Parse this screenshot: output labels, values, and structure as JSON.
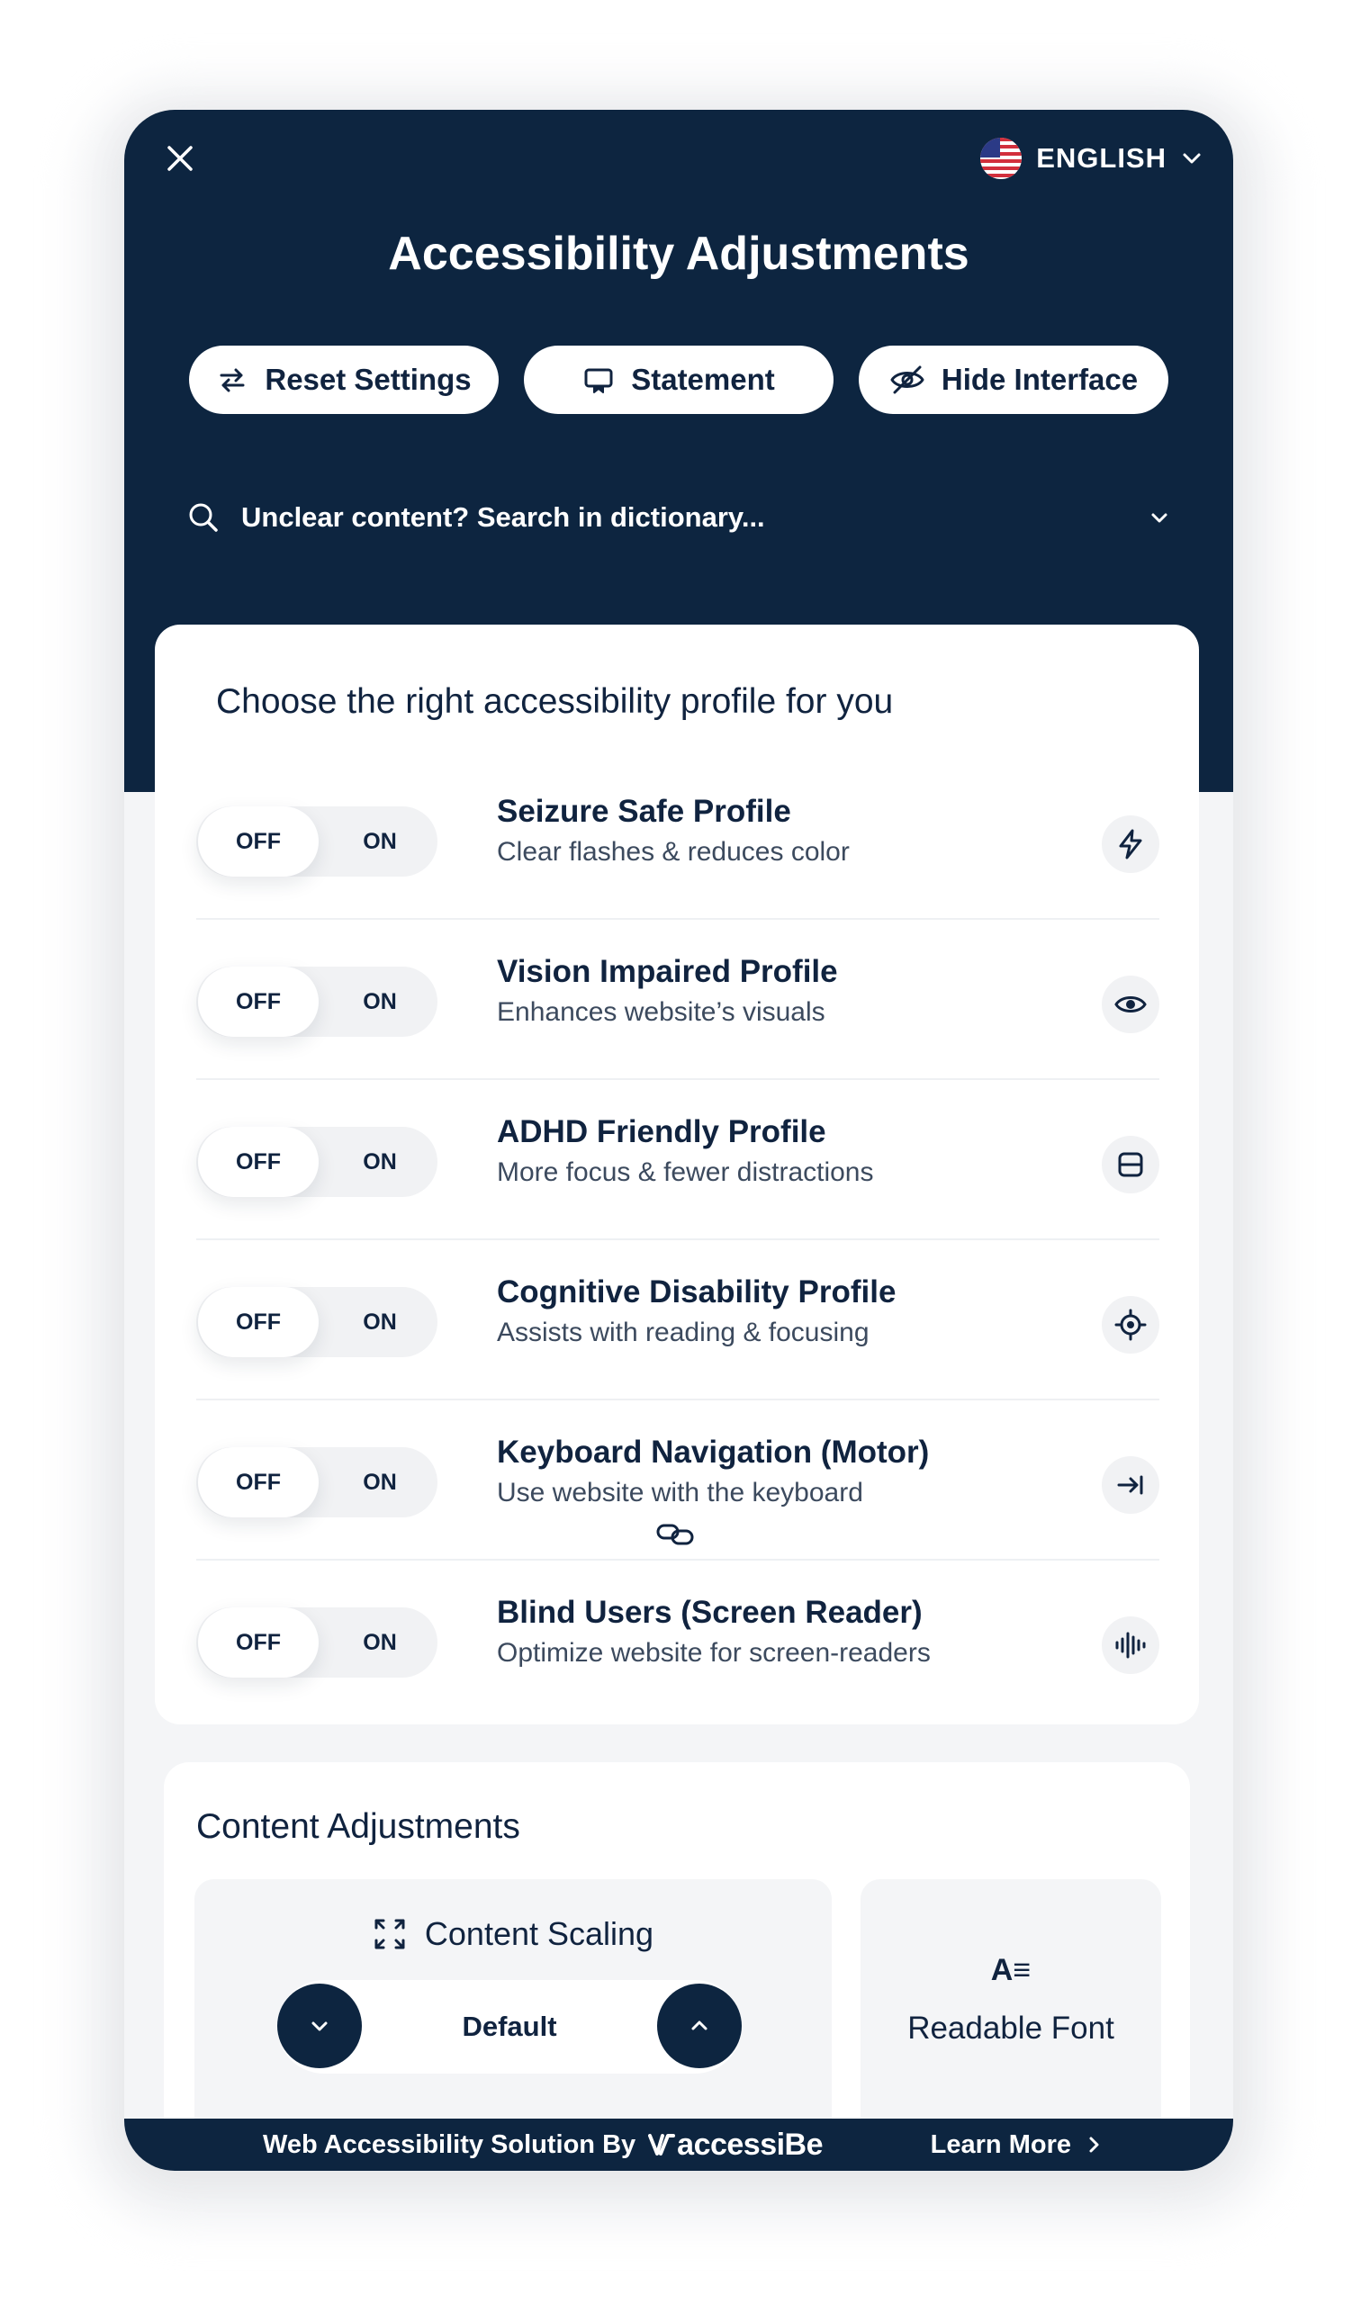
{
  "header": {
    "title": "Accessibility Adjustments",
    "language": "ENGLISH",
    "buttons": {
      "reset": "Reset Settings",
      "statement": "Statement",
      "hide": "Hide Interface"
    },
    "search_text": "Unclear content? Search in dictionary..."
  },
  "profiles": {
    "heading": "Choose the right accessibility profile for you",
    "toggle_off": "OFF",
    "toggle_on": "ON",
    "items": [
      {
        "title": "Seizure Safe Profile",
        "desc": "Clear flashes & reduces color",
        "icon": "lightning-icon"
      },
      {
        "title": "Vision Impaired Profile",
        "desc": "Enhances website’s visuals",
        "icon": "eye-icon"
      },
      {
        "title": "ADHD Friendly Profile",
        "desc": "More focus & fewer distractions",
        "icon": "focus-frame-icon"
      },
      {
        "title": "Cognitive Disability Profile",
        "desc": "Assists with reading & focusing",
        "icon": "target-icon"
      },
      {
        "title": "Keyboard Navigation (Motor)",
        "desc": "Use website with the keyboard",
        "icon": "arrow-to-line-icon"
      },
      {
        "title": "Blind Users (Screen Reader)",
        "desc": "Optimize website for screen-readers",
        "icon": "audio-wave-icon"
      }
    ]
  },
  "content": {
    "heading": "Content Adjustments",
    "scaling_label": "Content Scaling",
    "scaling_value": "Default",
    "font_glyph": "A≡",
    "font_label": "Readable Font"
  },
  "footer": {
    "credit": "Web Accessibility Solution By",
    "brand": "accessiBe",
    "learn_more": "Learn More"
  },
  "colors": {
    "navy": "#0d2540",
    "text": "#10233f",
    "panel_bg": "#f4f5f7"
  }
}
